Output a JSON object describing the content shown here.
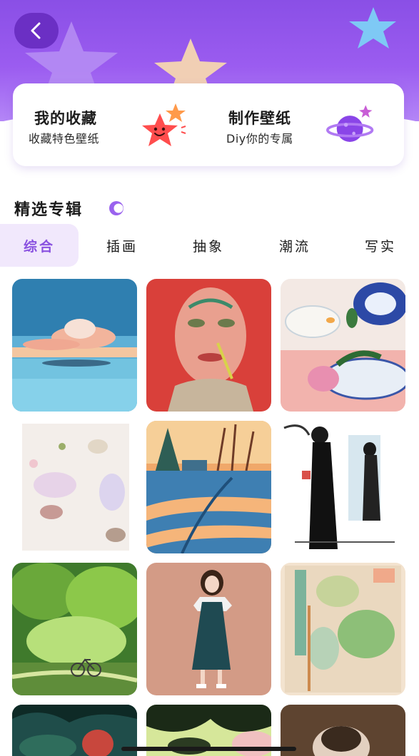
{
  "header": {
    "back_icon": "chevron-left-icon"
  },
  "features": [
    {
      "title": "我的收藏",
      "subtitle": "收藏特色壁纸",
      "icon": "smiling-star-icon"
    },
    {
      "title": "制作壁纸",
      "subtitle": "Diy你的专属",
      "icon": "planet-icon"
    }
  ],
  "section": {
    "title": "精选专辑"
  },
  "tabs": [
    {
      "label": "综合",
      "active": true
    },
    {
      "label": "插画",
      "active": false
    },
    {
      "label": "抽象",
      "active": false
    },
    {
      "label": "潮流",
      "active": false
    },
    {
      "label": "写实",
      "active": false
    }
  ],
  "colors": {
    "brand_purple": "#8a4fe6",
    "active_tab_bg": "#f1e8fc",
    "active_tab_text": "#8a52e0"
  },
  "wallpapers": [
    {
      "name": "whale-in-clouds"
    },
    {
      "name": "painted-face-portrait"
    },
    {
      "name": "blue-white-porcelain-flowers"
    },
    {
      "name": "abstract-watercolor-stains"
    },
    {
      "name": "snowy-road-sunset"
    },
    {
      "name": "woman-in-black-dress-sketch"
    },
    {
      "name": "green-forest-bicycle"
    },
    {
      "name": "girl-in-green-dress"
    },
    {
      "name": "abstract-green-drips"
    },
    {
      "name": "dark-foliage-scene"
    },
    {
      "name": "green-black-leaves"
    },
    {
      "name": "brown-portrait-scene"
    }
  ]
}
